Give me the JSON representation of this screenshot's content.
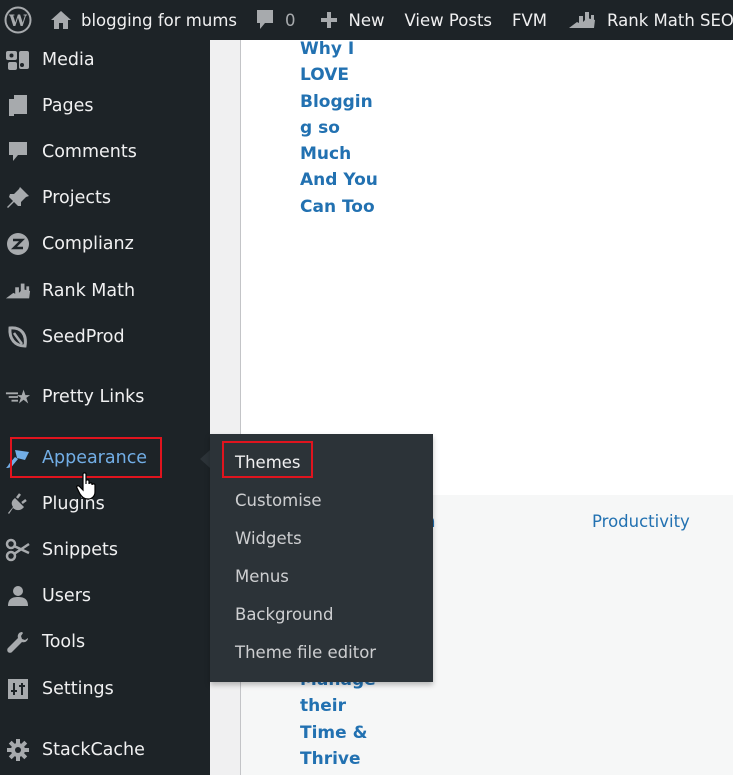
{
  "adminbar": {
    "wp_logo_icon": "wordpress-logo-icon",
    "site_name": "blogging for mums",
    "comments_count": "0",
    "new_label": "New",
    "view_posts_label": "View Posts",
    "fvm_label": "FVM",
    "rank_math_label": "Rank Math SEO"
  },
  "sidebar": {
    "items": [
      {
        "label": "Media",
        "icon": "media-icon"
      },
      {
        "label": "Pages",
        "icon": "pages-icon"
      },
      {
        "label": "Comments",
        "icon": "comments-icon"
      },
      {
        "label": "Projects",
        "icon": "pin-icon"
      },
      {
        "label": "Complianz",
        "icon": "complianz-icon"
      },
      {
        "label": "Rank Math",
        "icon": "rank-math-icon"
      },
      {
        "label": "SeedProd",
        "icon": "seedprod-icon"
      },
      {
        "label": "Pretty Links",
        "icon": "pretty-links-icon"
      },
      {
        "label": "Appearance",
        "icon": "paintbrush-icon"
      },
      {
        "label": "Plugins",
        "icon": "plugin-icon"
      },
      {
        "label": "Snippets",
        "icon": "scissors-icon"
      },
      {
        "label": "Users",
        "icon": "user-icon"
      },
      {
        "label": "Tools",
        "icon": "wrench-icon"
      },
      {
        "label": "Settings",
        "icon": "settings-icon"
      },
      {
        "label": "StackCache",
        "icon": "gear-icon"
      }
    ],
    "hovered": "Appearance"
  },
  "submenu": {
    "items": [
      "Themes",
      "Customise",
      "Widgets",
      "Menus",
      "Background",
      "Theme file editor"
    ],
    "highlighted": "Themes"
  },
  "content": {
    "post_title_top": [
      "Why I",
      "LOVE",
      "Bloggin",
      "g so",
      "Much",
      "And You",
      "Can Too"
    ],
    "category_partial": "n",
    "category": "Productivity",
    "post_title_bottom": [
      "Manage",
      "their",
      "Time &",
      "Thrive"
    ]
  },
  "colors": {
    "adminbar_bg": "#1d2327",
    "submenu_bg": "#2c3338",
    "link": "#2271b1",
    "hover": "#72aee6",
    "highlight": "#e0141e"
  }
}
